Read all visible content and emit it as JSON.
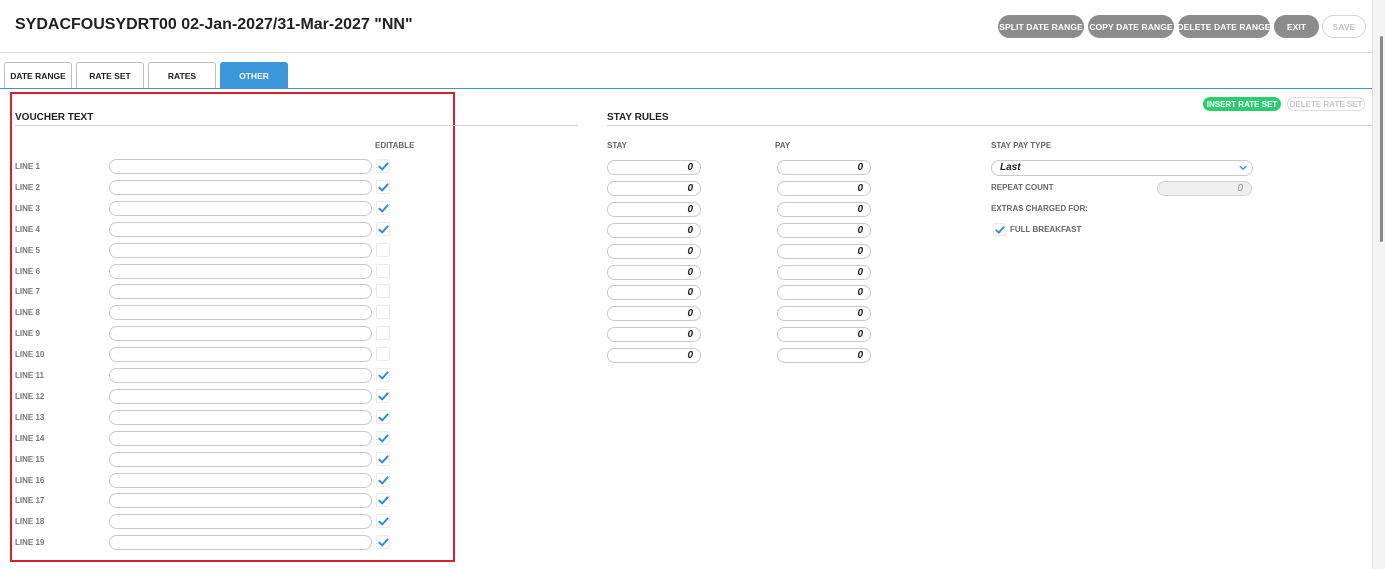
{
  "header": {
    "title": "SYDACFOUSYDRT00 02-Jan-2027/31-Mar-2027 \"NN\"",
    "buttons": {
      "split": "SPLIT DATE RANGE",
      "copy": "COPY DATE RANGE",
      "delete": "DELETE DATE RANGE",
      "exit": "EXIT",
      "save": "SAVE"
    }
  },
  "tabs": {
    "date_range": "DATE RANGE",
    "rate_set": "RATE SET",
    "rates": "RATES",
    "other": "OTHER",
    "active": "OTHER"
  },
  "voucher": {
    "title": "VOUCHER TEXT",
    "editable_label": "EDITABLE",
    "lines": [
      {
        "label": "LINE 1",
        "value": "",
        "editable": true
      },
      {
        "label": "LINE 2",
        "value": "",
        "editable": true
      },
      {
        "label": "LINE 3",
        "value": "",
        "editable": true
      },
      {
        "label": "LINE 4",
        "value": "",
        "editable": true
      },
      {
        "label": "LINE 5",
        "value": "",
        "editable": false
      },
      {
        "label": "LINE 6",
        "value": "",
        "editable": false
      },
      {
        "label": "LINE 7",
        "value": "",
        "editable": false
      },
      {
        "label": "LINE 8",
        "value": "",
        "editable": false
      },
      {
        "label": "LINE 9",
        "value": "",
        "editable": false
      },
      {
        "label": "LINE 10",
        "value": "",
        "editable": false
      },
      {
        "label": "LINE 11",
        "value": "",
        "editable": true
      },
      {
        "label": "LINE 12",
        "value": "",
        "editable": true
      },
      {
        "label": "LINE 13",
        "value": "",
        "editable": true
      },
      {
        "label": "LINE 14",
        "value": "",
        "editable": true
      },
      {
        "label": "LINE 15",
        "value": "",
        "editable": true
      },
      {
        "label": "LINE 16",
        "value": "",
        "editable": true
      },
      {
        "label": "LINE 17",
        "value": "",
        "editable": true
      },
      {
        "label": "LINE 18",
        "value": "",
        "editable": true
      },
      {
        "label": "LINE 19",
        "value": "",
        "editable": true
      }
    ]
  },
  "stay_rules": {
    "title": "STAY RULES",
    "stay_label": "STAY",
    "pay_label": "PAY",
    "insert_button": "INSERT RATE SET",
    "delete_button": "DELETE RATE SET",
    "rows": [
      {
        "stay": "0",
        "pay": "0"
      },
      {
        "stay": "0",
        "pay": "0"
      },
      {
        "stay": "0",
        "pay": "0"
      },
      {
        "stay": "0",
        "pay": "0"
      },
      {
        "stay": "0",
        "pay": "0"
      },
      {
        "stay": "0",
        "pay": "0"
      },
      {
        "stay": "0",
        "pay": "0"
      },
      {
        "stay": "0",
        "pay": "0"
      },
      {
        "stay": "0",
        "pay": "0"
      },
      {
        "stay": "0",
        "pay": "0"
      }
    ],
    "stay_pay_type_label": "STAY PAY TYPE",
    "stay_pay_type_value": "Last",
    "repeat_count_label": "REPEAT COUNT",
    "repeat_count_value": "0",
    "extras_label": "EXTRAS CHARGED FOR:",
    "extras": [
      {
        "label": "FULL BREAKFAST",
        "checked": true
      }
    ]
  },
  "colors": {
    "accent": "#3b97da",
    "check": "#2f8fd6",
    "green": "#2ecc71",
    "highlight": "#d4222a",
    "header_button": "#8c8c8c"
  },
  "icons": {
    "check": "check-icon",
    "dropdown": "chevron-down-icon"
  }
}
